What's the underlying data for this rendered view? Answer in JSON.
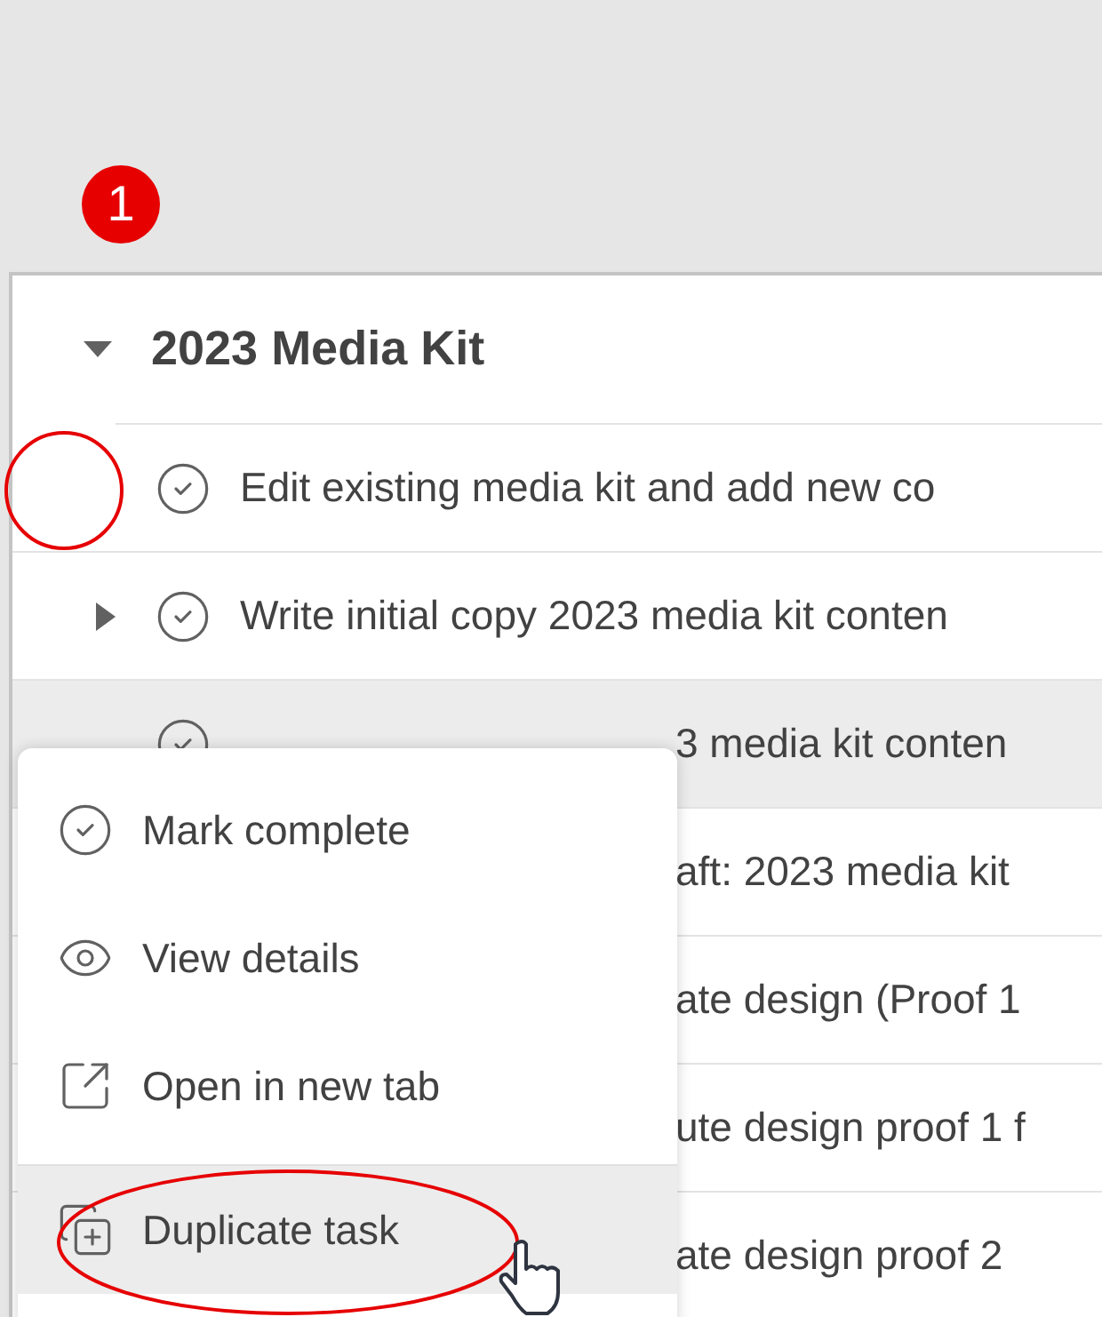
{
  "annotation": {
    "badge": "1"
  },
  "group": {
    "title": "2023 Media Kit",
    "expanded": true
  },
  "tasks": [
    {
      "kind": "full",
      "title": "Edit existing media kit and add new co",
      "expandable": false,
      "hovered": false
    },
    {
      "kind": "full",
      "title": "Write initial copy 2023 media kit conten",
      "expandable": true,
      "hovered": false
    },
    {
      "kind": "partly_covered",
      "title": "3 media kit conten",
      "hovered": true
    },
    {
      "kind": "covered",
      "title": "aft: 2023 media kit",
      "hovered": false
    },
    {
      "kind": "covered",
      "title": "ate design (Proof 1",
      "hovered": false
    },
    {
      "kind": "covered",
      "title": "ute design proof 1 f",
      "hovered": false
    },
    {
      "kind": "covered",
      "title": "ate design proof 2",
      "hovered": false
    }
  ],
  "context_menu": {
    "items": [
      {
        "label": "Mark complete",
        "hovered": false
      },
      {
        "label": "View details",
        "hovered": false
      },
      {
        "label": "Open in new tab",
        "hovered": false
      },
      {
        "label": "Duplicate task",
        "hovered": true
      }
    ]
  }
}
